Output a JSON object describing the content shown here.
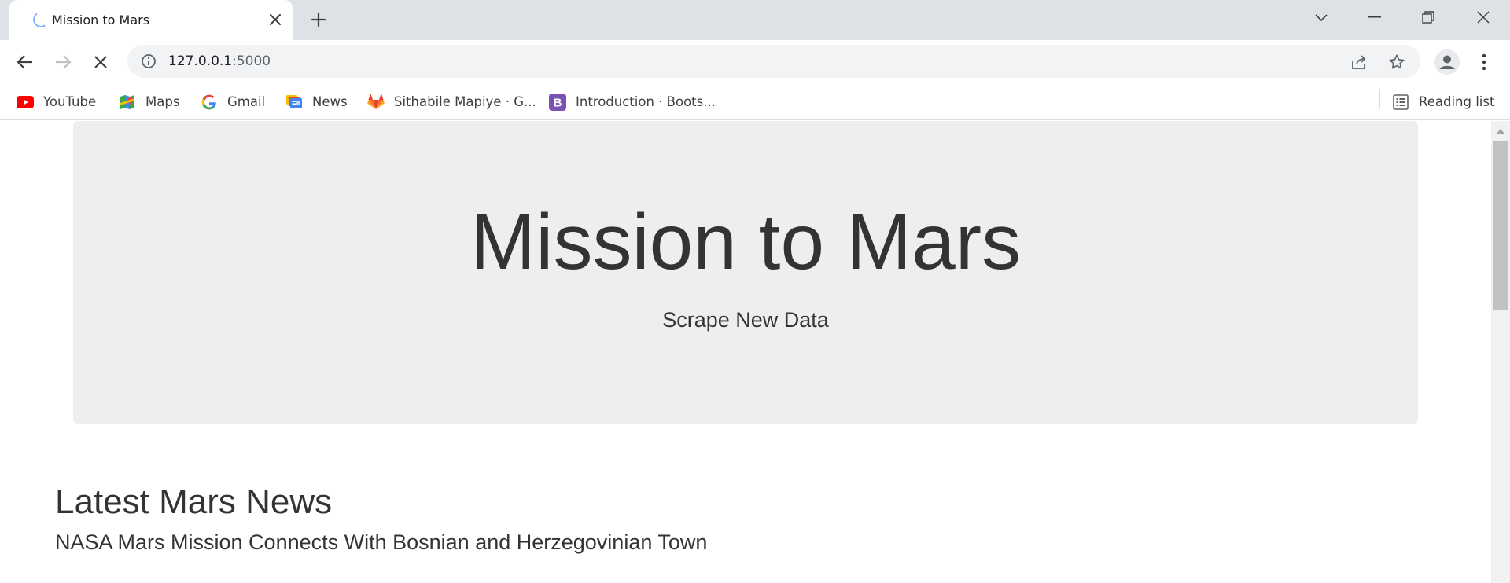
{
  "browser": {
    "tab": {
      "title": "Mission to Mars"
    },
    "address": {
      "host": "127.0.0.1",
      "port": ":5000"
    },
    "bookmarks": [
      {
        "label": "YouTube",
        "icon": "youtube-icon"
      },
      {
        "label": "Maps",
        "icon": "maps-icon"
      },
      {
        "label": "Gmail",
        "icon": "google-icon"
      },
      {
        "label": "News",
        "icon": "news-icon"
      },
      {
        "label": "Sithabile Mapiye · G...",
        "icon": "gitlab-icon"
      },
      {
        "label": "Introduction · Boots...",
        "icon": "bootstrap-icon"
      }
    ],
    "reading_list": {
      "label": "Reading list",
      "icon": "reading-list-icon"
    }
  },
  "page": {
    "jumbotron": {
      "title": "Mission to Mars",
      "button_label": "Scrape New Data"
    },
    "news": {
      "section_title": "Latest Mars News",
      "headline": "NASA Mars Mission Connects With Bosnian and Herzegovinian Town"
    }
  },
  "colors": {
    "tabstrip_bg": "#dee1e6",
    "omnibox_bg": "#f1f3f4",
    "jumbotron_bg": "#eeeeee",
    "text": "#333333",
    "youtube_red": "#ff0000",
    "gitlab_orange": "#e24329",
    "bootstrap_purple": "#7952b3"
  }
}
